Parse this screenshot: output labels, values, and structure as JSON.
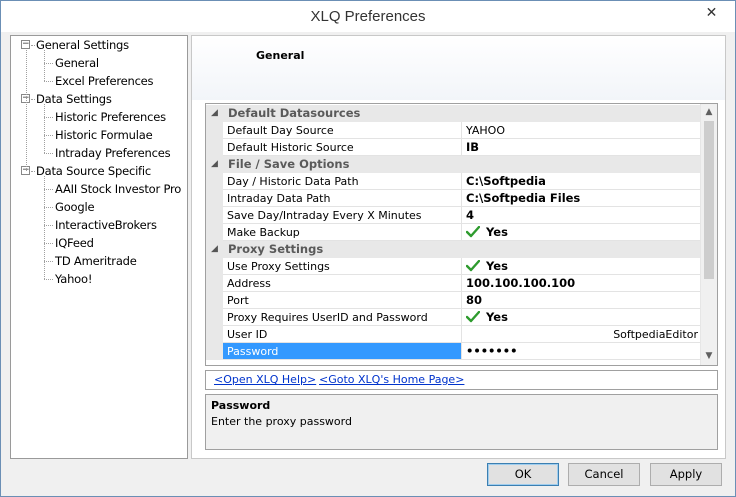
{
  "window": {
    "title": "XLQ Preferences",
    "close_glyph": "✕"
  },
  "nav": {
    "items": [
      {
        "label": "General Settings",
        "level": 0,
        "expander": "−"
      },
      {
        "label": "General",
        "level": 1
      },
      {
        "label": "Excel Preferences",
        "level": 1
      },
      {
        "label": "Data Settings",
        "level": 0,
        "expander": "−"
      },
      {
        "label": "Historic Preferences",
        "level": 1
      },
      {
        "label": "Historic Formulae",
        "level": 1
      },
      {
        "label": "Intraday Preferences",
        "level": 1
      },
      {
        "label": "Data Source Specific",
        "level": 0,
        "expander": "−"
      },
      {
        "label": "AAII Stock Investor Pro",
        "level": 1
      },
      {
        "label": "Google",
        "level": 1
      },
      {
        "label": "InteractiveBrokers",
        "level": 1
      },
      {
        "label": "IQFeed",
        "level": 1
      },
      {
        "label": "TD Ameritrade",
        "level": 1
      },
      {
        "label": "Yahoo!",
        "level": 1
      }
    ]
  },
  "content": {
    "title": "General"
  },
  "grid": {
    "rows": [
      {
        "type": "category",
        "label": "Default Datasources",
        "toggle": "◢"
      },
      {
        "type": "prop",
        "name": "Default Day Source",
        "value": "YAHOO",
        "bold": false
      },
      {
        "type": "prop",
        "name": "Default Historic Source",
        "value": "IB",
        "bold": true
      },
      {
        "type": "category",
        "label": "File / Save Options",
        "toggle": "◢"
      },
      {
        "type": "prop",
        "name": "Day / Historic Data Path",
        "value": "C:\\Softpedia",
        "bold": true
      },
      {
        "type": "prop",
        "name": "Intraday Data Path",
        "value": "C:\\Softpedia Files",
        "bold": true
      },
      {
        "type": "prop",
        "name": "Save Day/Intraday Every X Minutes",
        "value": "4",
        "bold": true
      },
      {
        "type": "prop",
        "name": "Make Backup",
        "value": "Yes",
        "bold": true,
        "check": true
      },
      {
        "type": "category",
        "label": "Proxy Settings",
        "toggle": "◢"
      },
      {
        "type": "prop",
        "name": "Use Proxy Settings",
        "value": "Yes",
        "bold": true,
        "check": true
      },
      {
        "type": "prop",
        "name": "Address",
        "value": "100.100.100.100",
        "bold": true
      },
      {
        "type": "prop",
        "name": "Port",
        "value": "80",
        "bold": true
      },
      {
        "type": "prop",
        "name": "Proxy Requires UserID and Password",
        "value": "Yes",
        "bold": true,
        "check": true
      },
      {
        "type": "prop",
        "name": "User ID",
        "value": "SoftpediaEditor",
        "bold": false,
        "right": true
      },
      {
        "type": "prop",
        "name": "Password",
        "value": "•••••••",
        "bold": true,
        "selected": true
      }
    ],
    "scroll_up_glyph": "▲",
    "scroll_down_glyph": "▼"
  },
  "links": {
    "help": "<Open XLQ Help>",
    "home": "<Goto XLQ's Home Page>"
  },
  "help": {
    "title": "Password",
    "text": "Enter the proxy password"
  },
  "buttons": {
    "ok": "OK",
    "cancel": "Cancel",
    "apply": "Apply"
  },
  "colors": {
    "selection": "#3399ff",
    "link": "#0033cc",
    "check": "#2e9b2e"
  },
  "icons": {
    "check": "check-icon",
    "close": "close-icon"
  }
}
